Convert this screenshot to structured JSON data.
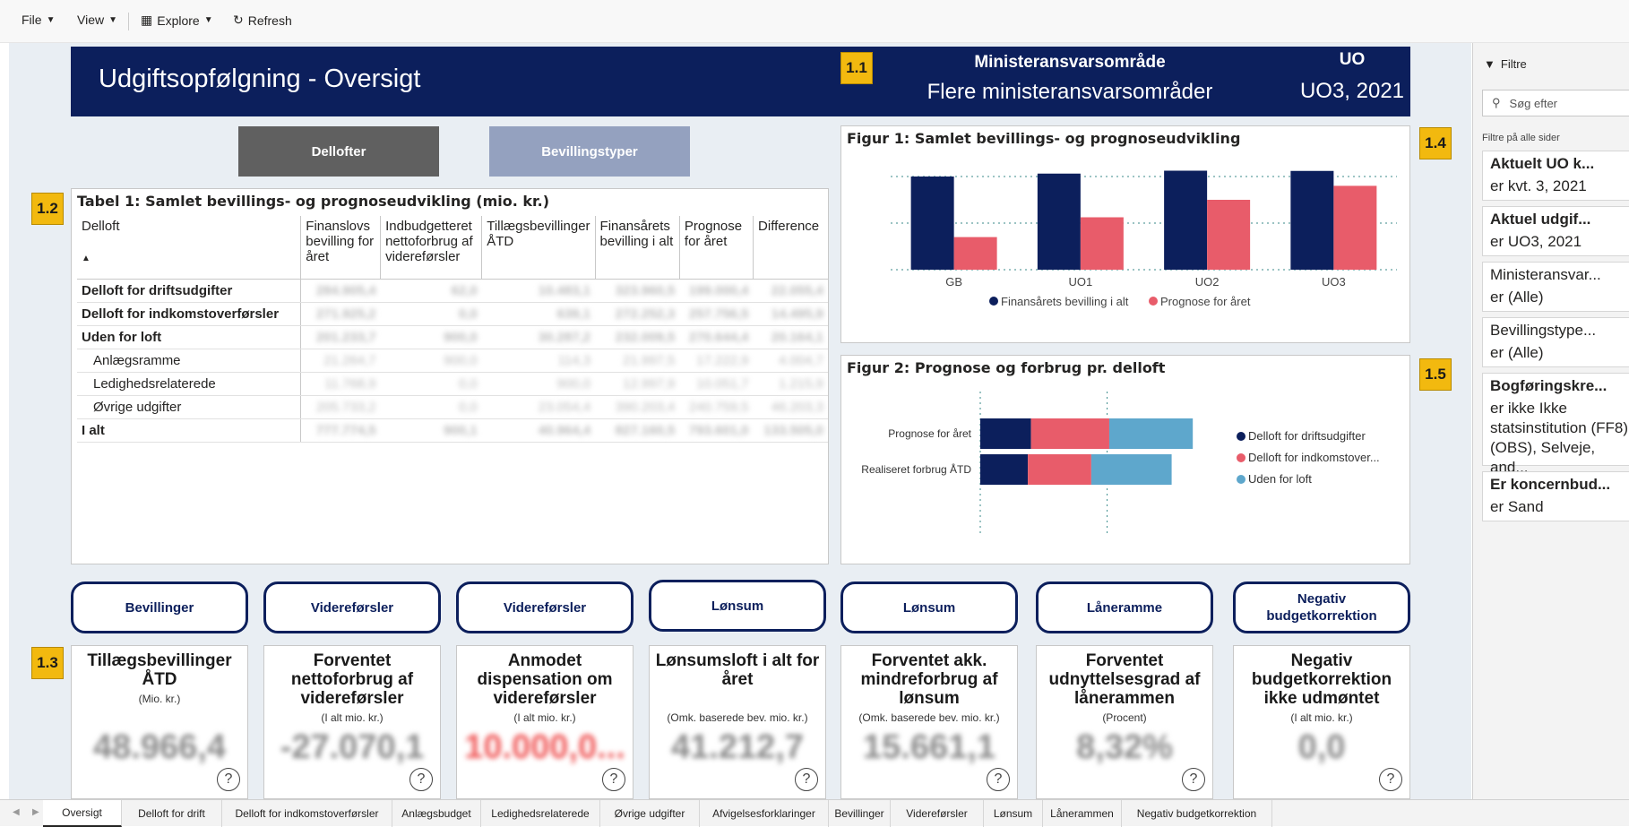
{
  "toolbar": {
    "file": "File",
    "view": "View",
    "explore": "Explore",
    "refresh": "Refresh"
  },
  "header": {
    "title": "Udgiftsopfølgning - Oversigt",
    "ministry_label": "Ministeransvarsområde",
    "ministry_value": "Flere ministeransvarsområder",
    "uo_label": "UO",
    "uo_value": "UO3, 2021"
  },
  "badges": {
    "b11": "1.1",
    "b12": "1.2",
    "b13": "1.3",
    "b14": "1.4",
    "b15": "1.5"
  },
  "nav": {
    "delofter": "Dellofter",
    "bevillingstyper": "Bevillingstyper"
  },
  "table": {
    "title": "Tabel 1: Samlet bevillings- og prognoseudvikling (mio. kr.)",
    "headers": [
      "Delloft",
      "Finanslovs bevilling for året",
      "Indbudgetteret nettoforbrug af videreførsler",
      "Tillægsbevillinger ÅTD",
      "Finansårets bevilling i alt",
      "Prognose for året",
      "Difference"
    ],
    "rows": [
      {
        "name": "Delloft for driftsudgifter",
        "values": [
          "284.905,4",
          "62,0",
          "10.483,1",
          "323.960,5",
          "199.000,4",
          "22.055,4"
        ]
      },
      {
        "name": "Delloft for indkomstoverførsler",
        "values": [
          "271.925,2",
          "0,0",
          "639,1",
          "272.252,3",
          "257.756,5",
          "14.495,9"
        ]
      },
      {
        "name": "Uden for loft",
        "values": [
          "201.233,7",
          "900,0",
          "30.287,2",
          "232.009,5",
          "270.644,4",
          "20.164,1"
        ]
      },
      {
        "name": "Anlægsramme",
        "values": [
          "21.264,7",
          "900,0",
          "114,3",
          "21.997,5",
          "17.222,9",
          "4.004,7"
        ]
      },
      {
        "name": "Ledighedsrelaterede",
        "values": [
          "11.768,9",
          "0,0",
          "900,0",
          "12.997,9",
          "10.051,7",
          "1.215,9"
        ]
      },
      {
        "name": "Øvrige udgifter",
        "values": [
          "205.733,2",
          "0,0",
          "23.054,4",
          "390.203,4",
          "240.759,5",
          "46.203,3"
        ]
      },
      {
        "name": "I alt",
        "values": [
          "777.774,5",
          "900,1",
          "40.964,4",
          "827.160,5",
          "793.601,0",
          "133.505,0"
        ]
      }
    ]
  },
  "figure1": {
    "title": "Figur 1: Samlet bevillings- og prognoseudvikling",
    "chart_data": {
      "type": "bar",
      "categories": [
        "GB",
        "UO1",
        "UO2",
        "UO3"
      ],
      "series": [
        {
          "name": "Finansårets bevilling i alt",
          "color": "#0c1f5c",
          "values": [
            800,
            825,
            850,
            848
          ]
        },
        {
          "name": "Prognose for året",
          "color": "#e85c6a",
          "values": [
            280,
            450,
            600,
            720
          ]
        }
      ],
      "ylim": [
        0,
        1000
      ]
    }
  },
  "figure2": {
    "title": "Figur 2: Prognose og forbrug pr. delloft",
    "chart_data": {
      "type": "bar",
      "orientation": "horizontal",
      "stacked": true,
      "categories": [
        "Prognose for året",
        "Realiseret forbrug ÅTD"
      ],
      "series": [
        {
          "name": "Delloft for driftsudgifter",
          "color": "#0c1f5c",
          "values": [
            48,
            45
          ]
        },
        {
          "name": "Delloft for indkomstover...",
          "color": "#e85c6a",
          "values": [
            74,
            60
          ]
        },
        {
          "name": "Uden for loft",
          "color": "#5ea7cc",
          "values": [
            79,
            76
          ]
        }
      ],
      "xlim": [
        0,
        250
      ]
    }
  },
  "pills": [
    "Bevillinger",
    "Videreførsler",
    "Videreførsler",
    "Lønsum",
    "Lønsum",
    "Låneramme",
    "Negativ budgetkorrektion"
  ],
  "cards": [
    {
      "title": "Tillægsbevillinger ÅTD",
      "sub": "(Mio. kr.)",
      "value": "48.966,4",
      "color": "#8a8a8a"
    },
    {
      "title": "Forventet nettoforbrug af videreførsler",
      "sub": "(I alt mio. kr.)",
      "value": "-27.070,1",
      "color": "#8a8a8a"
    },
    {
      "title": "Anmodet dispensation om videreførsler",
      "sub": "(I alt mio. kr.)",
      "value": "10.000,0...",
      "color": "#f05a5a"
    },
    {
      "title": "Lønsumsloft i alt for året",
      "sub": "(Omk. baserede bev. mio. kr.)",
      "value": "41.212,7",
      "color": "#8a8a8a"
    },
    {
      "title": "Forventet akk. mindreforbrug af lønsum",
      "sub": "(Omk. baserede bev. mio. kr.)",
      "value": "15.661,1",
      "color": "#8a8a8a"
    },
    {
      "title": "Forventet udnyttelsesgrad af lånerammen",
      "sub": "(Procent)",
      "value": "8,32%",
      "color": "#8a8a8a"
    },
    {
      "title": "Negativ budgetkorrektion ikke udmøntet",
      "sub": "(I alt mio. kr.)",
      "value": "0,0",
      "color": "#8a8a8a"
    }
  ],
  "filters": {
    "pane_title": "Filtre",
    "search_placeholder": "Søg efter",
    "section": "Filtre på alle sider",
    "items": [
      {
        "title": "Aktuelt UO k...",
        "value": "er kvt. 3, 2021"
      },
      {
        "title": "Aktuel udgif...",
        "value": "er UO3, 2021"
      },
      {
        "title": "Ministeransvar...",
        "value": "er (Alle)"
      },
      {
        "title": "Bevillingstype...",
        "value": "er (Alle)"
      },
      {
        "title": "Bogføringskre...",
        "value": "er ikke Ikke statsinstitution (FF8) (OBS), Selveje, and..."
      },
      {
        "title": "Er koncernbud...",
        "value": "er Sand"
      }
    ]
  },
  "tabs": [
    "Oversigt",
    "Delloft for drift",
    "Delloft for indkomstoverførsler",
    "Anlægsbudget",
    "Ledighedsrelaterede",
    "Øvrige udgifter",
    "Afvigelsesforklaringer",
    "Bevillinger",
    "Videreførsler",
    "Lønsum",
    "Lånerammen",
    "Negativ budgetkorrektion"
  ]
}
